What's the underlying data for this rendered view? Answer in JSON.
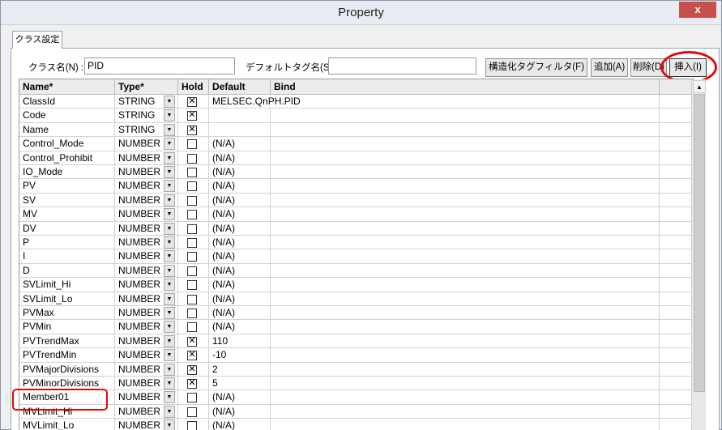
{
  "window": {
    "title": "Property",
    "close_label": "x"
  },
  "tab": {
    "label": "クラス設定"
  },
  "form": {
    "class_name_label": "クラス名(N) :",
    "class_name_value": "PID",
    "default_tag_label": "デフォルトタグ名(S) :",
    "default_tag_value": ""
  },
  "toolbar": {
    "struct_filter_label": "構造化タグフィルタ(F)",
    "add_label": "追加(A)",
    "delete_label": "削除(D)",
    "insert_label": "挿入(I)"
  },
  "grid": {
    "columns": [
      "Name*",
      "Type*",
      "Hold",
      "Default",
      "Bind"
    ],
    "rows": [
      {
        "name": "ClassId",
        "type": "STRING",
        "hold": true,
        "default": "MELSEC.QnPH.PID"
      },
      {
        "name": "Code",
        "type": "STRING",
        "hold": true,
        "default": ""
      },
      {
        "name": "Name",
        "type": "STRING",
        "hold": true,
        "default": ""
      },
      {
        "name": "Control_Mode",
        "type": "NUMBER",
        "hold": false,
        "default": "(N/A)"
      },
      {
        "name": "Control_Prohibit",
        "type": "NUMBER",
        "hold": false,
        "default": "(N/A)"
      },
      {
        "name": "IO_Mode",
        "type": "NUMBER",
        "hold": false,
        "default": "(N/A)"
      },
      {
        "name": "PV",
        "type": "NUMBER",
        "hold": false,
        "default": "(N/A)"
      },
      {
        "name": "SV",
        "type": "NUMBER",
        "hold": false,
        "default": "(N/A)"
      },
      {
        "name": "MV",
        "type": "NUMBER",
        "hold": false,
        "default": "(N/A)"
      },
      {
        "name": "DV",
        "type": "NUMBER",
        "hold": false,
        "default": "(N/A)"
      },
      {
        "name": "P",
        "type": "NUMBER",
        "hold": false,
        "default": "(N/A)"
      },
      {
        "name": "I",
        "type": "NUMBER",
        "hold": false,
        "default": "(N/A)"
      },
      {
        "name": "D",
        "type": "NUMBER",
        "hold": false,
        "default": "(N/A)"
      },
      {
        "name": "SVLimit_Hi",
        "type": "NUMBER",
        "hold": false,
        "default": "(N/A)"
      },
      {
        "name": "SVLimit_Lo",
        "type": "NUMBER",
        "hold": false,
        "default": "(N/A)"
      },
      {
        "name": "PVMax",
        "type": "NUMBER",
        "hold": false,
        "default": "(N/A)"
      },
      {
        "name": "PVMin",
        "type": "NUMBER",
        "hold": false,
        "default": "(N/A)"
      },
      {
        "name": "PVTrendMax",
        "type": "NUMBER",
        "hold": true,
        "default": "110"
      },
      {
        "name": "PVTrendMin",
        "type": "NUMBER",
        "hold": true,
        "default": "-10"
      },
      {
        "name": "PVMajorDivisions",
        "type": "NUMBER",
        "hold": true,
        "default": "2"
      },
      {
        "name": "PVMinorDivisions",
        "type": "NUMBER",
        "hold": true,
        "default": "5"
      },
      {
        "name": "Member01",
        "type": "NUMBER",
        "hold": false,
        "default": "(N/A)"
      },
      {
        "name": "MVLimit_Hi",
        "type": "NUMBER",
        "hold": false,
        "default": "(N/A)"
      },
      {
        "name": "MVLimit_Lo",
        "type": "NUMBER",
        "hold": false,
        "default": "(N/A)"
      }
    ]
  },
  "colors": {
    "highlight": "#e10a0a",
    "close_button": "#c7504b"
  },
  "icons": {
    "dropdown": "triangle-down-icon",
    "scroll_up": "triangle-up-icon",
    "check": "x-check-icon"
  }
}
